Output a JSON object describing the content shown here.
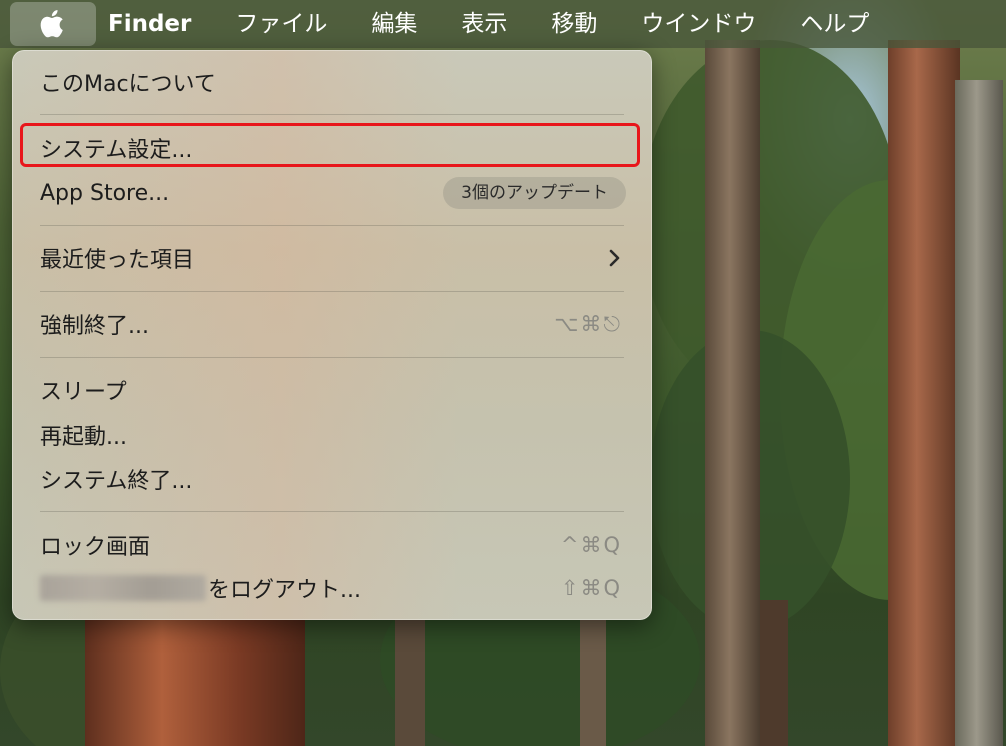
{
  "menubar": {
    "apple_icon": "apple-logo-icon",
    "app_name": "Finder",
    "items": [
      "ファイル",
      "編集",
      "表示",
      "移動",
      "ウインドウ",
      "ヘルプ"
    ]
  },
  "apple_menu": {
    "about": "このMacについて",
    "system_settings": "システム設定...",
    "app_store": "App Store...",
    "app_store_badge": "3個のアップデート",
    "recent_items": "最近使った項目",
    "recent_items_icon": "chevron-right-icon",
    "force_quit": "強制終了...",
    "force_quit_shortcut": "⌥⌘⎋",
    "sleep": "スリープ",
    "restart": "再起動...",
    "shut_down": "システム終了...",
    "lock_screen": "ロック画面",
    "lock_screen_shortcut": "^⌘Q",
    "log_out_suffix": "をログアウト...",
    "log_out_shortcut": "⇧⌘Q"
  },
  "colors": {
    "highlight_border": "#e8161b",
    "menu_text": "#1c1c1c",
    "shortcut_text": "#8b8a83"
  }
}
